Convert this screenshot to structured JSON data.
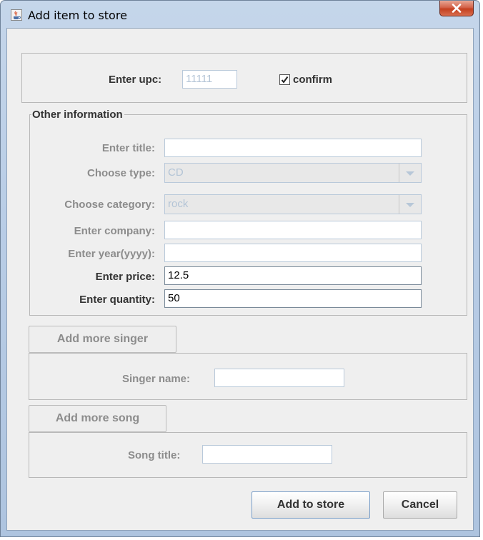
{
  "window": {
    "title": "Add item to store",
    "icon": "java-coffee-icon",
    "close_icon": "close-icon"
  },
  "upc_section": {
    "label": "Enter upc:",
    "value": "11111",
    "confirm_label": "confirm",
    "confirm_checked": true
  },
  "other_info": {
    "legend": "Other information",
    "title_label": "Enter title:",
    "title_value": "",
    "type_label": "Choose type:",
    "type_value": "CD",
    "category_label": "Choose category:",
    "category_value": "rock",
    "company_label": "Enter company:",
    "company_value": "",
    "year_label": "Enter year(yyyy):",
    "year_value": "",
    "price_label": "Enter price:",
    "price_value": "12.5",
    "quantity_label": "Enter quantity:",
    "quantity_value": "50"
  },
  "singer_section": {
    "add_button": "Add more singer",
    "name_label": "Singer name:",
    "name_value": ""
  },
  "song_section": {
    "add_button": "Add more song",
    "title_label": "Song title:",
    "title_value": ""
  },
  "actions": {
    "add_to_store": "Add to store",
    "cancel": "Cancel"
  },
  "colors": {
    "frame": "#b9cde6",
    "client_bg": "#efefef",
    "disabled_text": "#8c8c8c",
    "ghost_text": "#b3c4d6",
    "close_button": "#c4401f"
  }
}
